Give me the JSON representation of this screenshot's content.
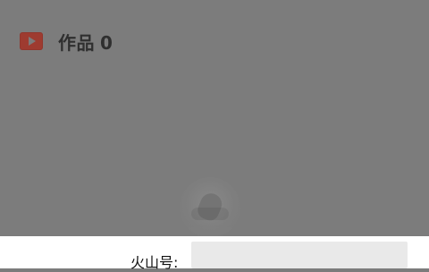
{
  "works": {
    "icon": "play-icon",
    "label": "作品",
    "count": "0"
  },
  "loading": {
    "icon": "app-logo-icon"
  },
  "bottom_sheet": {
    "id_label": "火山号:",
    "id_value": ""
  }
}
